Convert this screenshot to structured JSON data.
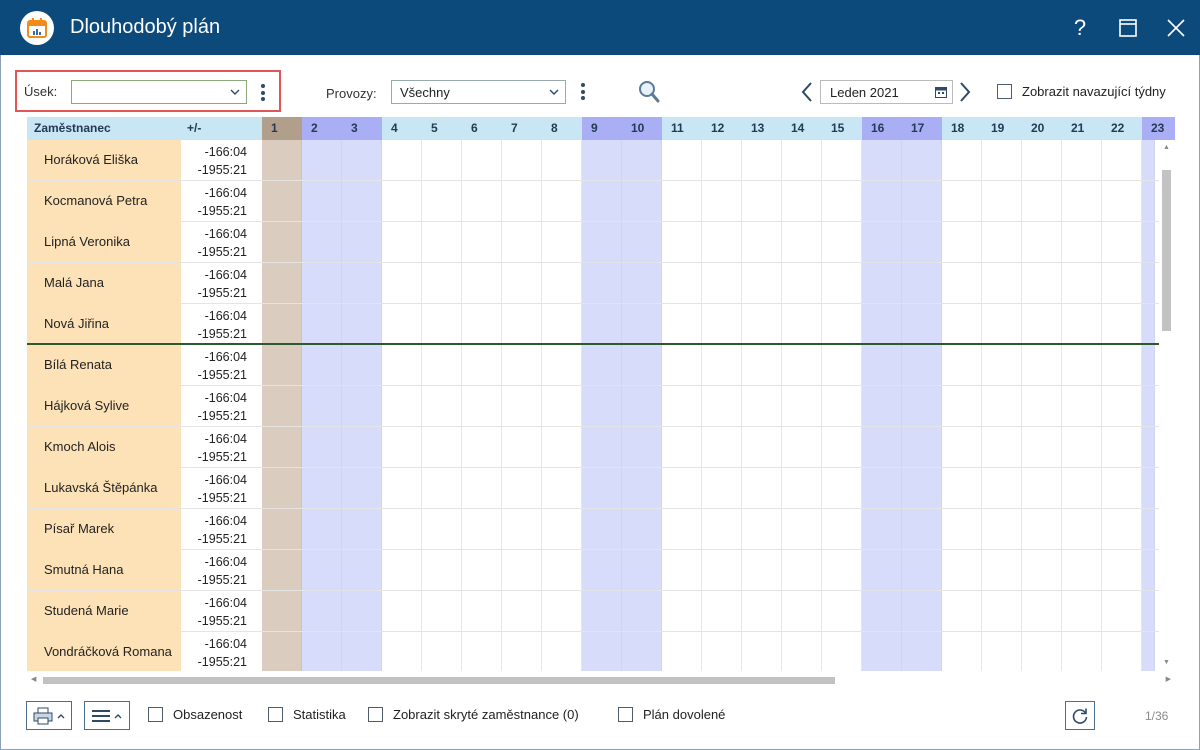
{
  "window": {
    "title": "Dlouhodobý plán",
    "help": "?"
  },
  "toolbar": {
    "usek_label": "Úsek:",
    "usek_value": "",
    "provozy_label": "Provozy:",
    "provozy_value": "Všechny",
    "month": "Leden 2021",
    "next_weeks_label": "Zobrazit navazující týdny"
  },
  "grid": {
    "col_employee": "Zaměstnanec",
    "col_diff": "+/-",
    "days": [
      "1",
      "2",
      "3",
      "4",
      "5",
      "6",
      "7",
      "8",
      "9",
      "10",
      "11",
      "12",
      "13",
      "14",
      "15",
      "16",
      "17",
      "18",
      "19",
      "20",
      "21",
      "22",
      "23"
    ],
    "weekend_days": [
      "2",
      "3",
      "9",
      "10",
      "16",
      "17",
      "23"
    ],
    "selected_day": "1",
    "group_separator_after_row": 5,
    "rows": [
      {
        "name": "Horáková Eliška",
        "diff1": "-166:04",
        "diff2": "-1955:21"
      },
      {
        "name": "Kocmanová Petra",
        "diff1": "-166:04",
        "diff2": "-1955:21"
      },
      {
        "name": "Lipná Veronika",
        "diff1": "-166:04",
        "diff2": "-1955:21"
      },
      {
        "name": "Malá Jana",
        "diff1": "-166:04",
        "diff2": "-1955:21"
      },
      {
        "name": "Nová Jiřina",
        "diff1": "-166:04",
        "diff2": "-1955:21"
      },
      {
        "name": "Bílá Renata",
        "diff1": "-166:04",
        "diff2": "-1955:21"
      },
      {
        "name": "Hájková Sylive",
        "diff1": "-166:04",
        "diff2": "-1955:21"
      },
      {
        "name": "Kmoch Alois",
        "diff1": "-166:04",
        "diff2": "-1955:21"
      },
      {
        "name": "Lukavská Štěpánka",
        "diff1": "-166:04",
        "diff2": "-1955:21"
      },
      {
        "name": "Písař Marek",
        "diff1": "-166:04",
        "diff2": "-1955:21"
      },
      {
        "name": "Smutná Hana",
        "diff1": "-166:04",
        "diff2": "-1955:21"
      },
      {
        "name": "Studená Marie",
        "diff1": "-166:04",
        "diff2": "-1955:21"
      },
      {
        "name": "Vondráčková Romana",
        "diff1": "-166:04",
        "diff2": "-1955:21"
      }
    ]
  },
  "bottom": {
    "obsazenost": "Obsazenost",
    "statistika": "Statistika",
    "hidden_employees": "Zobrazit skryté zaměstnance (0)",
    "vacation_plan": "Plán dovolené",
    "pager": "1/36"
  },
  "colors": {
    "titlebar": "#0d4a7c",
    "weekend": "#d7dcfa",
    "name_cell": "#fde2b7",
    "highlight": "#e05555"
  }
}
